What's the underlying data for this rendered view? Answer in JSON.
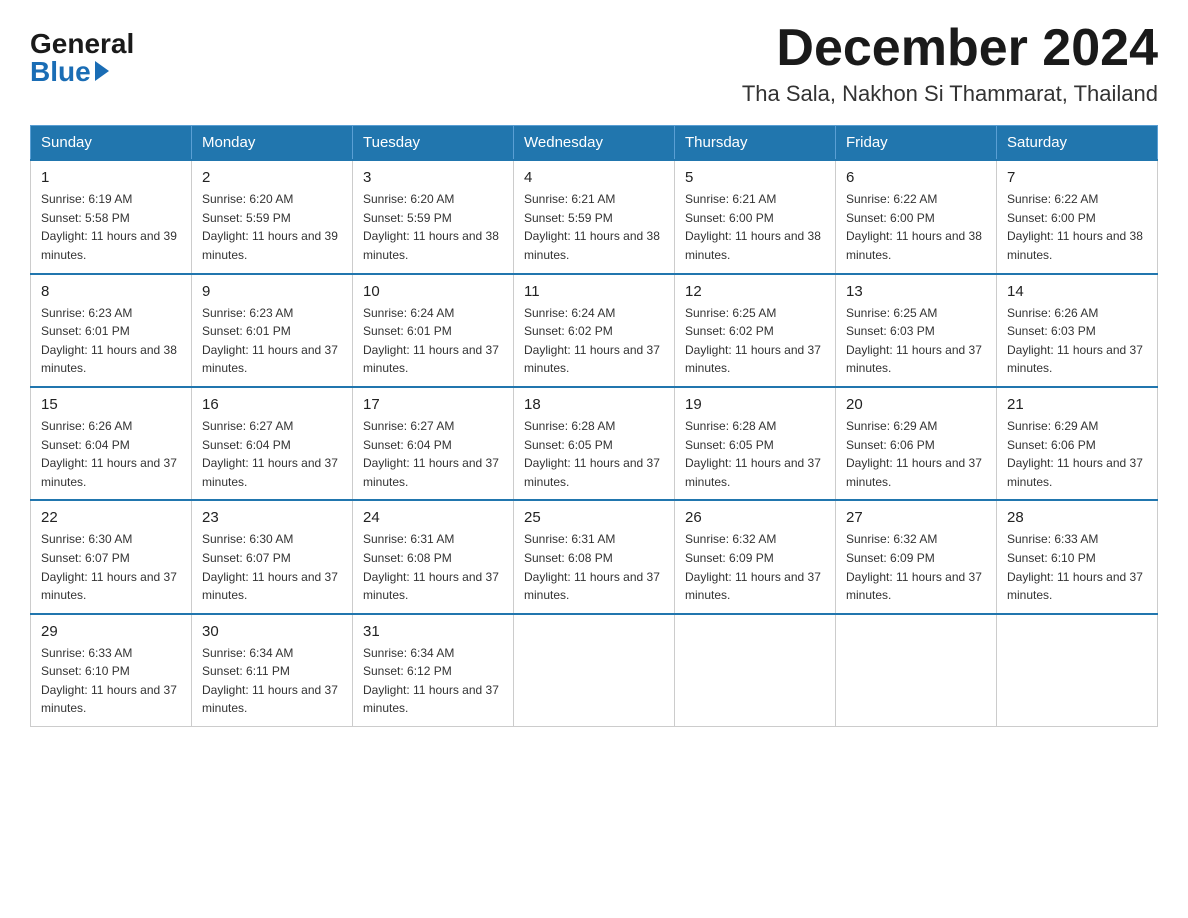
{
  "header": {
    "logo_general": "General",
    "logo_blue": "Blue",
    "month_year": "December 2024",
    "location": "Tha Sala, Nakhon Si Thammarat, Thailand"
  },
  "days_of_week": [
    "Sunday",
    "Monday",
    "Tuesday",
    "Wednesday",
    "Thursday",
    "Friday",
    "Saturday"
  ],
  "weeks": [
    [
      {
        "day": "1",
        "sunrise": "6:19 AM",
        "sunset": "5:58 PM",
        "daylight": "11 hours and 39 minutes."
      },
      {
        "day": "2",
        "sunrise": "6:20 AM",
        "sunset": "5:59 PM",
        "daylight": "11 hours and 39 minutes."
      },
      {
        "day": "3",
        "sunrise": "6:20 AM",
        "sunset": "5:59 PM",
        "daylight": "11 hours and 38 minutes."
      },
      {
        "day": "4",
        "sunrise": "6:21 AM",
        "sunset": "5:59 PM",
        "daylight": "11 hours and 38 minutes."
      },
      {
        "day": "5",
        "sunrise": "6:21 AM",
        "sunset": "6:00 PM",
        "daylight": "11 hours and 38 minutes."
      },
      {
        "day": "6",
        "sunrise": "6:22 AM",
        "sunset": "6:00 PM",
        "daylight": "11 hours and 38 minutes."
      },
      {
        "day": "7",
        "sunrise": "6:22 AM",
        "sunset": "6:00 PM",
        "daylight": "11 hours and 38 minutes."
      }
    ],
    [
      {
        "day": "8",
        "sunrise": "6:23 AM",
        "sunset": "6:01 PM",
        "daylight": "11 hours and 38 minutes."
      },
      {
        "day": "9",
        "sunrise": "6:23 AM",
        "sunset": "6:01 PM",
        "daylight": "11 hours and 37 minutes."
      },
      {
        "day": "10",
        "sunrise": "6:24 AM",
        "sunset": "6:01 PM",
        "daylight": "11 hours and 37 minutes."
      },
      {
        "day": "11",
        "sunrise": "6:24 AM",
        "sunset": "6:02 PM",
        "daylight": "11 hours and 37 minutes."
      },
      {
        "day": "12",
        "sunrise": "6:25 AM",
        "sunset": "6:02 PM",
        "daylight": "11 hours and 37 minutes."
      },
      {
        "day": "13",
        "sunrise": "6:25 AM",
        "sunset": "6:03 PM",
        "daylight": "11 hours and 37 minutes."
      },
      {
        "day": "14",
        "sunrise": "6:26 AM",
        "sunset": "6:03 PM",
        "daylight": "11 hours and 37 minutes."
      }
    ],
    [
      {
        "day": "15",
        "sunrise": "6:26 AM",
        "sunset": "6:04 PM",
        "daylight": "11 hours and 37 minutes."
      },
      {
        "day": "16",
        "sunrise": "6:27 AM",
        "sunset": "6:04 PM",
        "daylight": "11 hours and 37 minutes."
      },
      {
        "day": "17",
        "sunrise": "6:27 AM",
        "sunset": "6:04 PM",
        "daylight": "11 hours and 37 minutes."
      },
      {
        "day": "18",
        "sunrise": "6:28 AM",
        "sunset": "6:05 PM",
        "daylight": "11 hours and 37 minutes."
      },
      {
        "day": "19",
        "sunrise": "6:28 AM",
        "sunset": "6:05 PM",
        "daylight": "11 hours and 37 minutes."
      },
      {
        "day": "20",
        "sunrise": "6:29 AM",
        "sunset": "6:06 PM",
        "daylight": "11 hours and 37 minutes."
      },
      {
        "day": "21",
        "sunrise": "6:29 AM",
        "sunset": "6:06 PM",
        "daylight": "11 hours and 37 minutes."
      }
    ],
    [
      {
        "day": "22",
        "sunrise": "6:30 AM",
        "sunset": "6:07 PM",
        "daylight": "11 hours and 37 minutes."
      },
      {
        "day": "23",
        "sunrise": "6:30 AM",
        "sunset": "6:07 PM",
        "daylight": "11 hours and 37 minutes."
      },
      {
        "day": "24",
        "sunrise": "6:31 AM",
        "sunset": "6:08 PM",
        "daylight": "11 hours and 37 minutes."
      },
      {
        "day": "25",
        "sunrise": "6:31 AM",
        "sunset": "6:08 PM",
        "daylight": "11 hours and 37 minutes."
      },
      {
        "day": "26",
        "sunrise": "6:32 AM",
        "sunset": "6:09 PM",
        "daylight": "11 hours and 37 minutes."
      },
      {
        "day": "27",
        "sunrise": "6:32 AM",
        "sunset": "6:09 PM",
        "daylight": "11 hours and 37 minutes."
      },
      {
        "day": "28",
        "sunrise": "6:33 AM",
        "sunset": "6:10 PM",
        "daylight": "11 hours and 37 minutes."
      }
    ],
    [
      {
        "day": "29",
        "sunrise": "6:33 AM",
        "sunset": "6:10 PM",
        "daylight": "11 hours and 37 minutes."
      },
      {
        "day": "30",
        "sunrise": "6:34 AM",
        "sunset": "6:11 PM",
        "daylight": "11 hours and 37 minutes."
      },
      {
        "day": "31",
        "sunrise": "6:34 AM",
        "sunset": "6:12 PM",
        "daylight": "11 hours and 37 minutes."
      },
      null,
      null,
      null,
      null
    ]
  ]
}
